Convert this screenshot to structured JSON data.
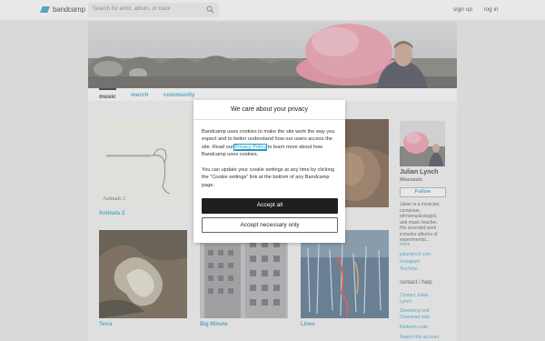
{
  "topbar": {
    "logo_text": "bandcamp",
    "search_placeholder": "Search for artist, album, or track",
    "signup_label": "sign up",
    "login_label": "log in"
  },
  "nav": {
    "tabs": [
      {
        "label": "music"
      },
      {
        "label": "merch"
      },
      {
        "label": "community"
      }
    ]
  },
  "albums": [
    {
      "title": "Animals 2",
      "cover_text": "Animals 2"
    },
    {
      "title": "Terra"
    },
    {
      "title": "Big Minute"
    },
    {
      "title": "Lines"
    }
  ],
  "sidebar": {
    "artist_name": "Julian Lynch",
    "location": "Wisconsin",
    "follow_label": "Follow",
    "bio_lines": [
      "Julian is a musician,",
      "composer,",
      "ethnomusicologist,",
      "and music teacher.",
      "His recorded work",
      "includes albums of",
      "experimental..."
    ],
    "more_label": "more",
    "links": [
      "julianlynch.com",
      "Instagram",
      "YouTube"
    ],
    "contact_heading": "contact / help",
    "help_links": [
      "Contact Julian Lynch",
      "Streaming and Download help",
      "Redeem code",
      "Report this account"
    ]
  },
  "cookie_modal": {
    "title": "We care about your privacy",
    "para1_before": "Bandcamp uses cookies to make the site work the way you expect and to better understand how our users access the site. Read our ",
    "policy_link": "Privacy Policy",
    "para1_after": " to learn more about how Bandcamp uses cookies.",
    "para2": "You can update your cookie settings at any time by clicking the “Cookie settings” link at the bottom of any Bandcamp page.",
    "accept_all_label": "Accept all",
    "accept_necessary_label": "Accept necessary only"
  },
  "colors": {
    "accent": "#1d9ac7",
    "primary_button": "#1f1f1f"
  }
}
